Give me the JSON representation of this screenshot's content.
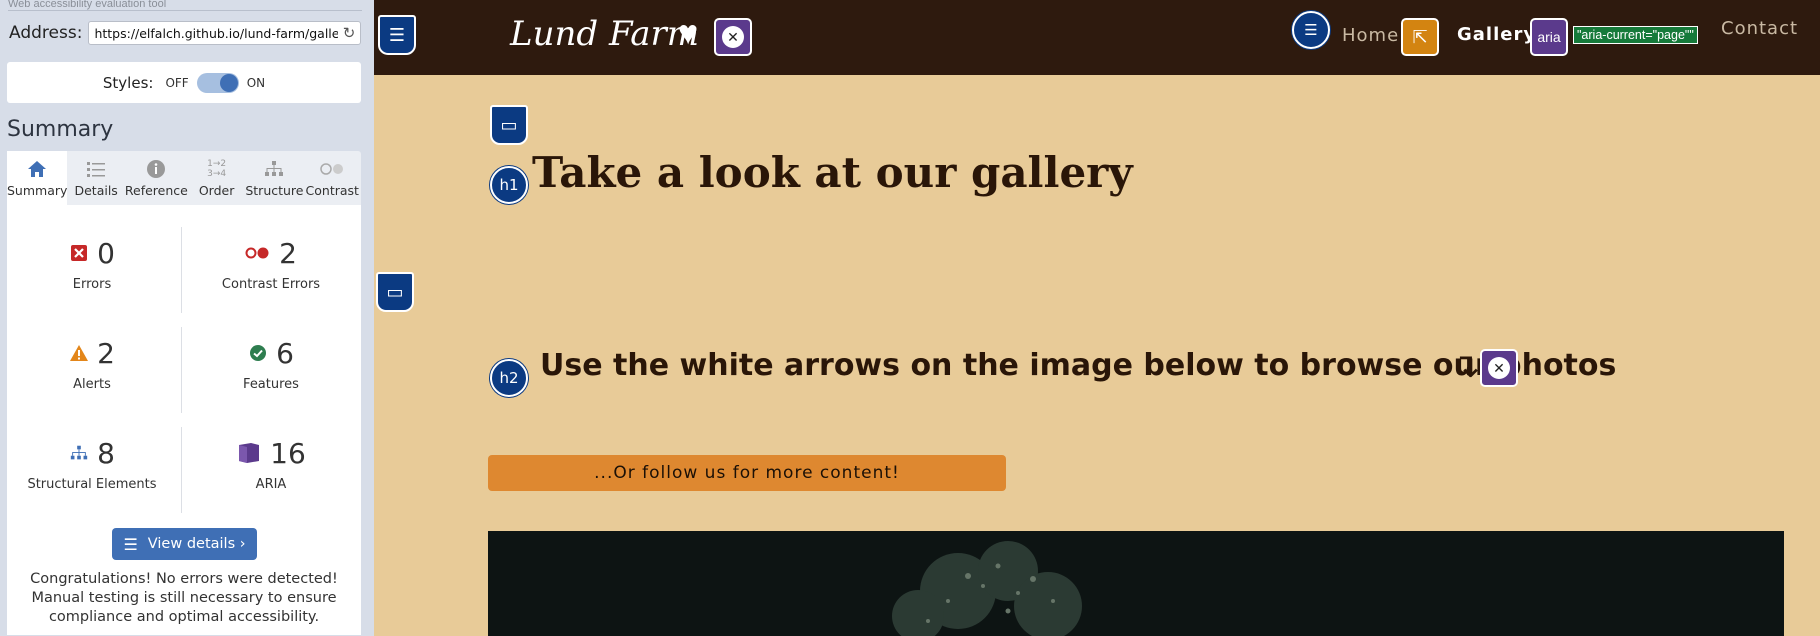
{
  "wave": {
    "top_caption": "Web accessibility evaluation tool",
    "address_label": "Address:",
    "address_value": "https://elfalch.github.io/lund-farm/gallery.htm",
    "styles_label": "Styles:",
    "off_label": "OFF",
    "on_label": "ON",
    "summary_title": "Summary",
    "tabs": [
      {
        "label": "Summary",
        "icon": "home-icon"
      },
      {
        "label": "Details",
        "icon": "list-icon"
      },
      {
        "label": "Reference",
        "icon": "info-icon"
      },
      {
        "label": "Order",
        "icon": "order-icon"
      },
      {
        "label": "Structure",
        "icon": "structure-icon"
      },
      {
        "label": "Contrast",
        "icon": "contrast-icon"
      }
    ],
    "stats": {
      "errors": {
        "value": "0",
        "label": "Errors"
      },
      "contrast_errors": {
        "value": "2",
        "label": "Contrast Errors"
      },
      "alerts": {
        "value": "2",
        "label": "Alerts"
      },
      "features": {
        "value": "6",
        "label": "Features"
      },
      "structural": {
        "value": "8",
        "label": "Structural Elements"
      },
      "aria": {
        "value": "16",
        "label": "ARIA"
      }
    },
    "view_details_label": "View details ›",
    "congrats_text": "Congratulations! No errors were detected! Manual testing is still necessary to ensure compliance and optimal accessibility."
  },
  "site": {
    "title": "Lund Farm",
    "nav": {
      "home": "Home",
      "gallery": "Gallery",
      "contact": "Contact",
      "aria_current_badge": "\"aria-current=\"page\"\"",
      "aria_badge": "aria"
    },
    "h1": "Take a look at our gallery",
    "h1_badge": "h1",
    "h2": "Use the white arrows on the image below to browse our photos",
    "h2_badge": "h2",
    "follow_button": "...Or follow us for more content!"
  },
  "colors": {
    "topbar": "#2e1a0e",
    "page_bg": "#e8cb98",
    "button": "#de8830",
    "wave_blue": "#3f6fb5"
  }
}
